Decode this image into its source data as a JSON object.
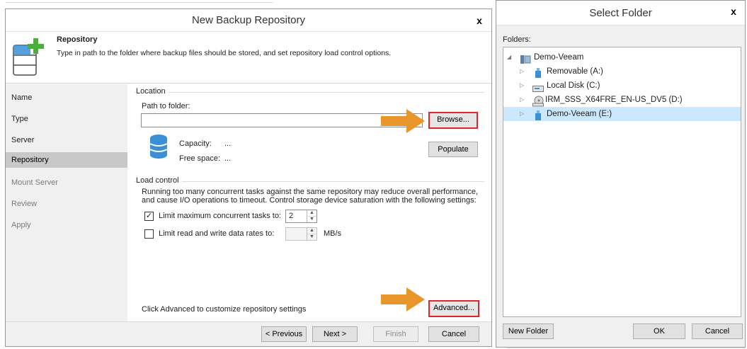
{
  "wizard": {
    "title": "New Backup Repository",
    "close_glyph": "x",
    "header": {
      "title": "Repository",
      "description": "Type in path to the folder where backup files should be stored, and set repository load control options."
    },
    "steps": [
      {
        "label": "Name",
        "state": "done"
      },
      {
        "label": "Type",
        "state": "done"
      },
      {
        "label": "Server",
        "state": "done"
      },
      {
        "label": "Repository",
        "state": "active"
      },
      {
        "label": "Mount Server",
        "state": "disabled"
      },
      {
        "label": "Review",
        "state": "disabled"
      },
      {
        "label": "Apply",
        "state": "disabled"
      }
    ],
    "location": {
      "group_label": "Location",
      "path_label": "Path to folder:",
      "path_value": "",
      "browse_button": "Browse...",
      "populate_button": "Populate",
      "capacity_label": "Capacity:",
      "capacity_value": "...",
      "free_space_label": "Free space:",
      "free_space_value": "..."
    },
    "load_control": {
      "group_label": "Load control",
      "description_line1": "Running too many concurrent tasks against the same repository may reduce overall performance,",
      "description_line2": "and cause I/O operations to timeout. Control storage device saturation with the following settings:",
      "limit_tasks_label": "Limit maximum concurrent tasks to:",
      "limit_tasks_checked": true,
      "limit_tasks_value": "2",
      "limit_rate_label": "Limit read and write data rates to:",
      "limit_rate_checked": false,
      "limit_rate_value": "",
      "limit_rate_unit": "MB/s"
    },
    "advanced": {
      "hint": "Click Advanced to customize repository settings",
      "button": "Advanced..."
    },
    "footer": {
      "previous": "< Previous",
      "next": "Next >",
      "finish": "Finish",
      "cancel": "Cancel"
    }
  },
  "select_folder": {
    "title": "Select Folder",
    "close_glyph": "x",
    "folders_label": "Folders:",
    "tree": [
      {
        "label": "Demo-Veeam",
        "level": 0,
        "expanded": true,
        "icon": "server-icon"
      },
      {
        "label": "Removable (A:)",
        "level": 1,
        "expanded": false,
        "icon": "usb-drive-icon"
      },
      {
        "label": "Local Disk (C:)",
        "level": 1,
        "expanded": false,
        "icon": "hard-disk-icon"
      },
      {
        "label": "IRM_SSS_X64FRE_EN-US_DV5 (D:)",
        "level": 1,
        "expanded": false,
        "icon": "dvd-drive-icon"
      },
      {
        "label": "Demo-Veeam (E:)",
        "level": 1,
        "expanded": false,
        "icon": "usb-drive-icon",
        "selected": true
      }
    ],
    "new_folder_button": "New Folder",
    "ok_button": "OK",
    "cancel_button": "Cancel"
  },
  "colors": {
    "highlight_border": "#e0262d",
    "arrow": "#e8952b",
    "selected_step": "#c8c8c8",
    "tree_selection": "#cce8ff",
    "repository_icon": "#3a8fd6",
    "plus_icon": "#4caf3a"
  }
}
